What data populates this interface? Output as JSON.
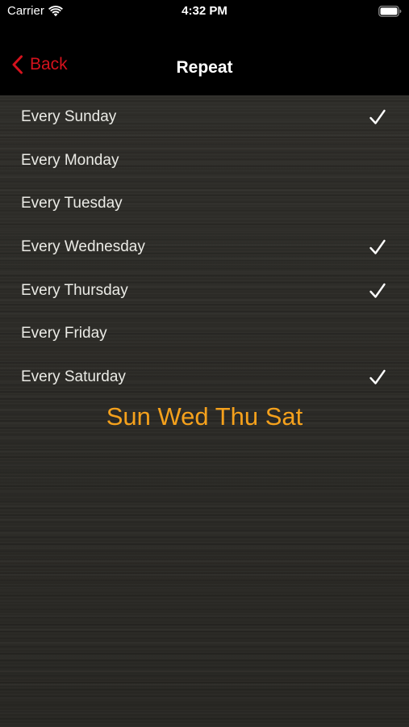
{
  "status_bar": {
    "carrier": "Carrier",
    "time": "4:32 PM",
    "wifi_icon": "wifi-icon",
    "battery_icon": "battery-icon"
  },
  "nav": {
    "back_label": "Back",
    "back_icon": "chevron-left-icon",
    "title": "Repeat"
  },
  "days": [
    {
      "label": "Every Sunday",
      "checked": true
    },
    {
      "label": "Every Monday",
      "checked": false
    },
    {
      "label": "Every Tuesday",
      "checked": false
    },
    {
      "label": "Every Wednesday",
      "checked": true
    },
    {
      "label": "Every Thursday",
      "checked": true
    },
    {
      "label": "Every Friday",
      "checked": false
    },
    {
      "label": "Every Saturday",
      "checked": true
    }
  ],
  "summary": "Sun Wed Thu Sat",
  "colors": {
    "accent": "#d4121d",
    "summary": "#f5a11c",
    "background": "#2b2a26",
    "bar": "#000000"
  }
}
